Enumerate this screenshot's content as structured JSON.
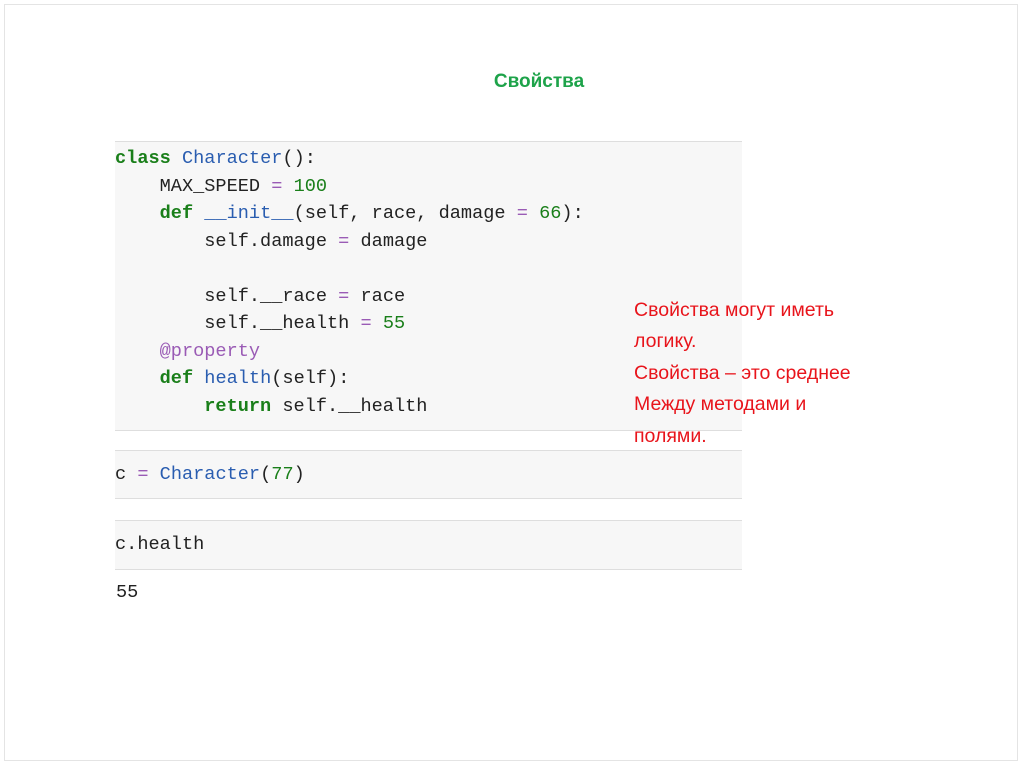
{
  "slide": {
    "title": "Свойства"
  },
  "cells": {
    "class_def": {
      "lines": [
        "class Character():",
        "    MAX_SPEED = 100",
        "    def __init__(self, race, damage = 66):",
        "        self.damage = damage",
        "",
        "        self.__race = race",
        "        self.__health = 55",
        "    @property",
        "    def health(self):",
        "        return self.__health"
      ]
    },
    "instantiate": {
      "code": "c = Character(77)"
    },
    "access": {
      "code": "c.health"
    },
    "output": "55"
  },
  "note": {
    "lines": [
      "Свойства могут иметь",
      "логику.",
      "Свойства – это среднее",
      "Между методами и",
      "полями."
    ]
  },
  "colors": {
    "title": "#1ea34a",
    "keyword": "#1a7f1a",
    "class_name": "#2a5db0",
    "operator": "#9a5bb5",
    "note": "#e8141b",
    "cell_bg": "#f7f7f7"
  }
}
